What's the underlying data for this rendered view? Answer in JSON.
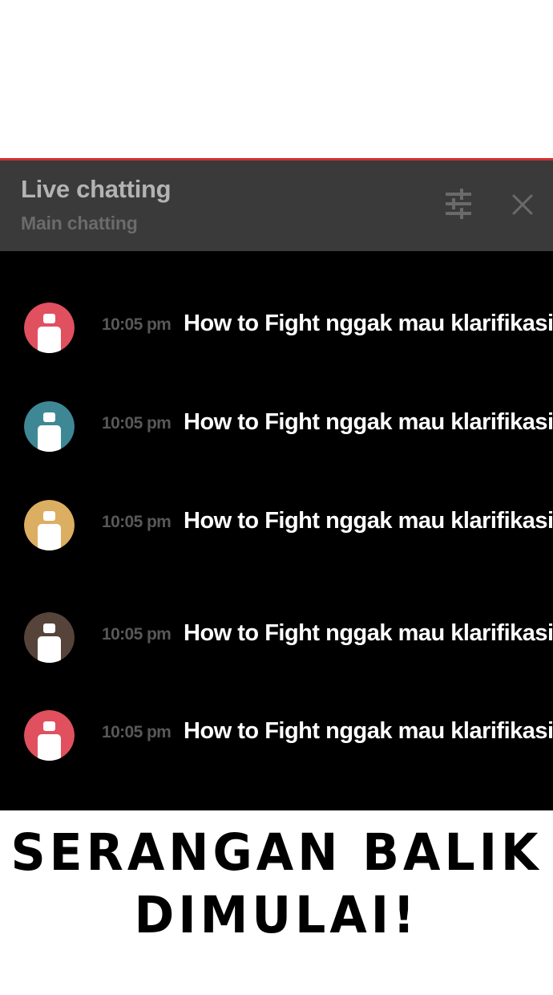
{
  "header": {
    "title": "Live chatting",
    "subtitle": "Main chatting",
    "filter_icon": "sliders-icon",
    "close_icon": "close-icon"
  },
  "colors": {
    "accent": "#d32f2f",
    "header_bg": "#3a3a3a",
    "chat_bg": "#000000"
  },
  "messages": [
    {
      "time": "10:05 pm",
      "text": "How to Fight nggak mau klarifikasi?",
      "avatar_color": "#e0505f"
    },
    {
      "time": "10:05 pm",
      "text": "How to Fight nggak mau klarifikasi?",
      "avatar_color": "#3e8896"
    },
    {
      "time": "10:05 pm",
      "text": "How to Fight nggak mau klarifikasi?",
      "avatar_color": "#dcae62"
    },
    {
      "time": "10:05 pm",
      "text": "How to Fight nggak mau klarifikasi?",
      "avatar_color": "#56443a"
    },
    {
      "time": "10:05 pm",
      "text": "How to Fight nggak mau klarifikasi?",
      "avatar_color": "#e0505f"
    }
  ],
  "caption": {
    "line1": "SERANGAN BALIK",
    "line2": "DIMULAI!"
  }
}
